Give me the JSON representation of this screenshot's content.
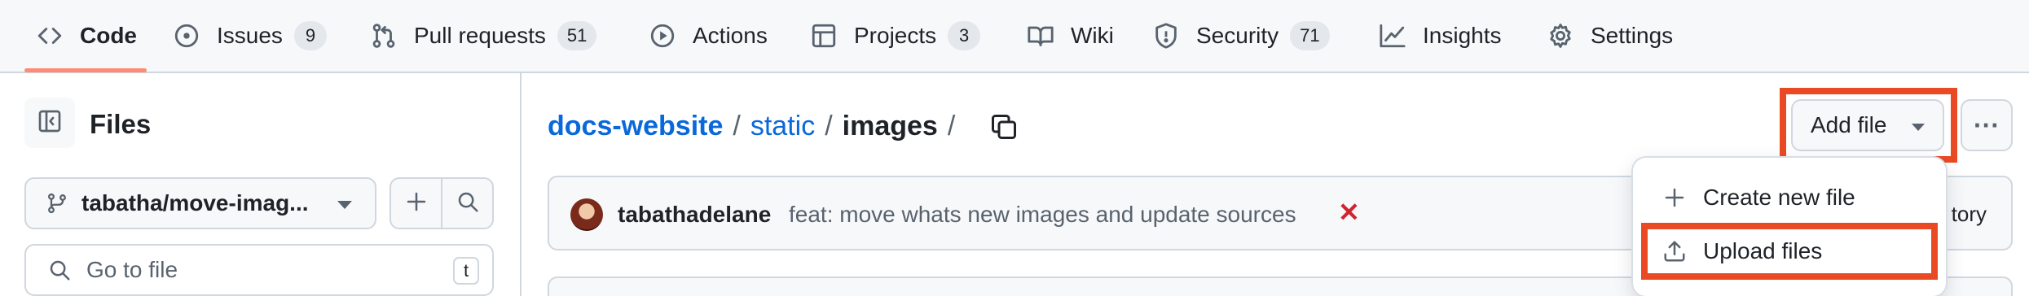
{
  "nav": {
    "tabs": [
      {
        "label": "Code",
        "icon": "code-icon",
        "active": true
      },
      {
        "label": "Issues",
        "icon": "issue-opened-icon",
        "count": "9"
      },
      {
        "label": "Pull requests",
        "icon": "git-pull-request-icon",
        "count": "51"
      },
      {
        "label": "Actions",
        "icon": "play-icon"
      },
      {
        "label": "Projects",
        "icon": "table-icon",
        "count": "3"
      },
      {
        "label": "Wiki",
        "icon": "book-icon"
      },
      {
        "label": "Security",
        "icon": "shield-icon",
        "count": "71"
      },
      {
        "label": "Insights",
        "icon": "graph-icon"
      },
      {
        "label": "Settings",
        "icon": "gear-icon"
      }
    ]
  },
  "sidebar": {
    "title": "Files",
    "branch": "tabatha/move-imag...",
    "goto_placeholder": "Go to file",
    "goto_shortcut": "t"
  },
  "breadcrumb": {
    "repo": "docs-website",
    "sep": "/",
    "folder": "static",
    "current": "images"
  },
  "toolbar": {
    "add_file": "Add file",
    "more": "···"
  },
  "commit": {
    "author": "tabathadelane",
    "message": "feat: move whats new images and update sources",
    "status": "✕",
    "right_text": "tory"
  },
  "menu": {
    "items": [
      {
        "label": "Create new file",
        "icon": "plus-icon"
      },
      {
        "label": "Upload files",
        "icon": "upload-icon"
      }
    ]
  },
  "colors": {
    "accent_link": "#0969da",
    "highlight": "#ea4a23",
    "active_underline": "#fd8c73",
    "fail": "#d1242f"
  }
}
